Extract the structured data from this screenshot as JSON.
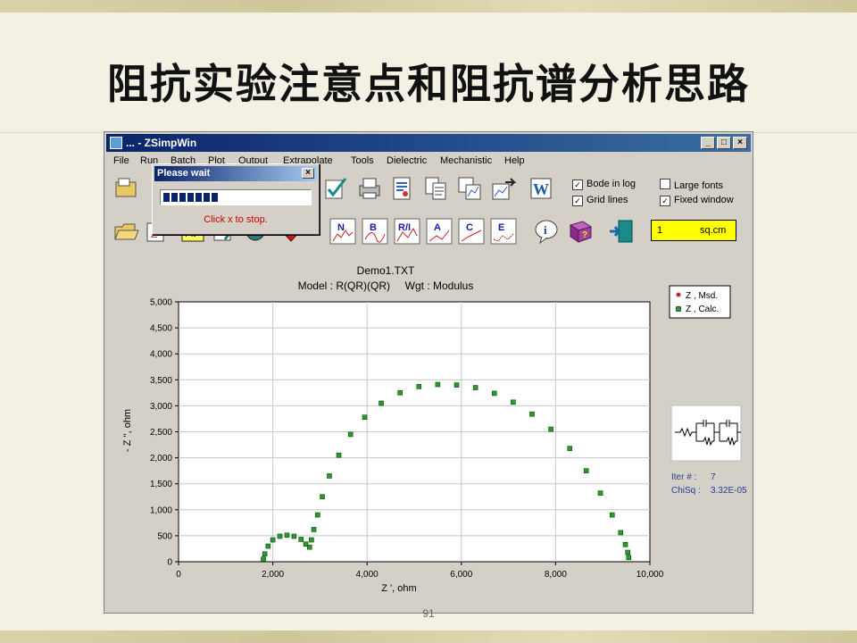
{
  "slide": {
    "title": "阻抗实验注意点和阻抗谱分析思路",
    "page_number": "91"
  },
  "window": {
    "title": "... - ZSimpWin",
    "controls": [
      "_",
      "□",
      "×"
    ]
  },
  "menu": [
    "File",
    "Run",
    "Batch",
    "Plot",
    "Output",
    "Extrapolate",
    "Tools",
    "Dielectric",
    "Mechanistic",
    "Help"
  ],
  "options": [
    {
      "label": "Bode in log",
      "checked": true
    },
    {
      "label": "Grid lines",
      "checked": true
    },
    {
      "label": "Large fonts",
      "checked": false
    },
    {
      "label": "Fixed window",
      "checked": true
    }
  ],
  "toolbar2_labels": [
    "N",
    "B",
    "R/I",
    "A",
    "C",
    "E"
  ],
  "area_field": {
    "value": "1",
    "unit": "sq.cm"
  },
  "dialog": {
    "title": "Please wait",
    "close": "×",
    "message": "Click x to stop.",
    "progress": 0.38
  },
  "colors": {
    "msd": "#b03030",
    "calc": "#2d9a2d",
    "titlebar": "#0a246a",
    "area_bg": "#ffff00"
  },
  "fit_info": {
    "iter_label": "Iter # :",
    "iter_value": "7",
    "chisq_label": "ChiSq :",
    "chisq_value": "3.32E-05"
  },
  "chart_data": {
    "type": "scatter",
    "title": "Demo1.TXT",
    "subtitle": "Model : R(QR)(QR)     Wgt : Modulus",
    "xlabel": "Z ', ohm",
    "ylabel": "- Z '', ohm",
    "xlim": [
      0,
      10000
    ],
    "ylim": [
      0,
      5000
    ],
    "xticks": [
      "0",
      "2,000",
      "4,000",
      "6,000",
      "8,000",
      "10,000"
    ],
    "yticks": [
      "0",
      "500",
      "1,000",
      "1,500",
      "2,000",
      "2,500",
      "3,000",
      "3,500",
      "4,000",
      "4,500",
      "5,000"
    ],
    "grid": true,
    "legend": "top-right",
    "series": [
      {
        "name": "Z , Msd.",
        "marker": "circle",
        "x": [
          1800,
          1830,
          1900,
          2000,
          2150,
          2300,
          2450,
          2600,
          2700,
          2780,
          2820,
          2870,
          2950,
          3050,
          3200,
          3400,
          3650,
          3950,
          4300,
          4700,
          5100,
          5500,
          5900,
          6300,
          6700,
          7100,
          7500,
          7900,
          8300,
          8650,
          8950,
          9200,
          9380,
          9480,
          9530,
          9550
        ],
        "y": [
          50,
          150,
          300,
          420,
          490,
          510,
          490,
          430,
          340,
          280,
          420,
          620,
          900,
          1250,
          1650,
          2050,
          2450,
          2780,
          3050,
          3250,
          3370,
          3410,
          3400,
          3350,
          3240,
          3070,
          2840,
          2550,
          2180,
          1750,
          1320,
          900,
          560,
          330,
          180,
          80
        ]
      },
      {
        "name": "Z , Calc.",
        "marker": "square",
        "x": [
          1800,
          1830,
          1900,
          2000,
          2150,
          2300,
          2450,
          2600,
          2700,
          2780,
          2820,
          2870,
          2950,
          3050,
          3200,
          3400,
          3650,
          3950,
          4300,
          4700,
          5100,
          5500,
          5900,
          6300,
          6700,
          7100,
          7500,
          7900,
          8300,
          8650,
          8950,
          9200,
          9380,
          9480,
          9530,
          9550
        ],
        "y": [
          50,
          150,
          300,
          420,
          490,
          510,
          490,
          430,
          340,
          280,
          420,
          620,
          900,
          1250,
          1650,
          2050,
          2450,
          2780,
          3050,
          3250,
          3370,
          3410,
          3400,
          3350,
          3240,
          3070,
          2840,
          2550,
          2180,
          1750,
          1320,
          900,
          560,
          330,
          180,
          80
        ]
      }
    ]
  }
}
